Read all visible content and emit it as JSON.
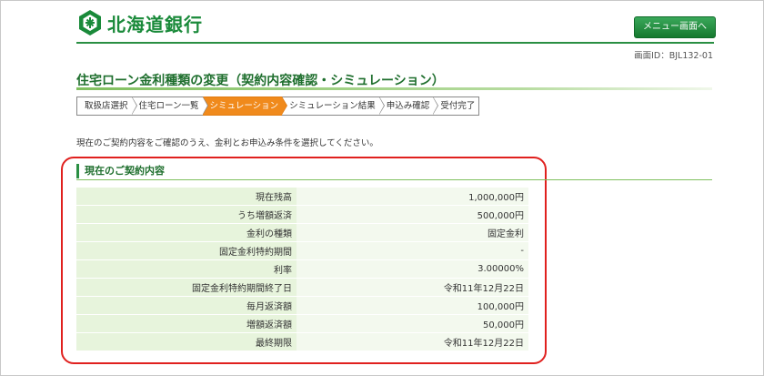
{
  "header": {
    "bank_name": "北海道銀行",
    "menu_button": "メニュー画面へ",
    "screen_id": "画面ID：BJL132-01"
  },
  "page": {
    "title": "住宅ローン金利種類の変更（契約内容確認・シミュレーション）",
    "intro": "現在のご契約内容をご確認のうえ、金利とお申込み条件を選択してください。"
  },
  "steps": [
    {
      "label": "取扱店選択",
      "active": false
    },
    {
      "label": "住宅ローン一覧",
      "active": false
    },
    {
      "label": "シミュレーション",
      "active": true
    },
    {
      "label": "シミュレーション結果",
      "active": false
    },
    {
      "label": "申込み確認",
      "active": false
    },
    {
      "label": "受付完了",
      "active": false
    }
  ],
  "contract": {
    "section_title": "現在のご契約内容",
    "rows": [
      {
        "label": "現在残高",
        "value": "1,000,000円"
      },
      {
        "label": "うち増額返済",
        "value": "500,000円"
      },
      {
        "label": "金利の種類",
        "value": "固定金利"
      },
      {
        "label": "固定金利特約期間",
        "value": "-"
      },
      {
        "label": "利率",
        "value": "3.00000%"
      },
      {
        "label": "固定金利特約期間終了日",
        "value": "令和11年12月22日"
      },
      {
        "label": "毎月返済額",
        "value": "100,000円"
      },
      {
        "label": "増額返済額",
        "value": "50,000円"
      },
      {
        "label": "最終期限",
        "value": "令和11年12月22日"
      }
    ]
  },
  "colors": {
    "brand_green": "#1a8a3a",
    "active_step": "#f08a1c",
    "highlight_box": "#e0201e"
  }
}
